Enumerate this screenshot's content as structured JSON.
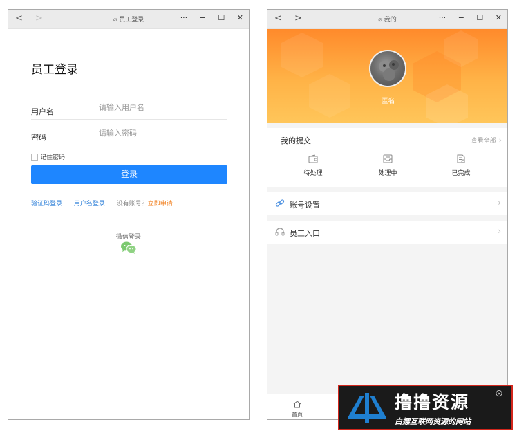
{
  "login_window": {
    "nav": {
      "back": "<",
      "forward": ">"
    },
    "title": "员工登录",
    "controls": {
      "more": "···",
      "minimize": "−",
      "maximize": "☐",
      "close": "✕"
    },
    "heading": "员工登录",
    "username": {
      "label": "用户名",
      "placeholder": "请输入用户名"
    },
    "password": {
      "label": "密码",
      "placeholder": "请输入密码"
    },
    "remember_label": "记住密码",
    "login_button": "登录",
    "links": {
      "sms_login": "验证码登录",
      "username_login": "用户名登录",
      "no_account": "没有账号？",
      "apply_now": "立即申请"
    },
    "wechat_label": "微信登录",
    "colors": {
      "primary": "#1e86ff",
      "link": "#2b7ed8",
      "apply": "#f07b17",
      "wechat": "#7bc96f"
    }
  },
  "profile_window": {
    "nav": {
      "back": "<",
      "forward": ">"
    },
    "title": "我的",
    "controls": {
      "more": "···",
      "minimize": "−",
      "maximize": "☐",
      "close": "✕"
    },
    "username": "匿名",
    "submissions": {
      "title": "我的提交",
      "view_all": "查看全部",
      "statuses": [
        {
          "label": "待处理",
          "icon": "wallet-icon"
        },
        {
          "label": "处理中",
          "icon": "inbox-icon"
        },
        {
          "label": "已完成",
          "icon": "document-done-icon"
        }
      ]
    },
    "menu": [
      {
        "label": "账号设置",
        "icon": "link-icon"
      },
      {
        "label": "员工入口",
        "icon": "headset-icon"
      }
    ],
    "tabbar": {
      "home": "首页"
    },
    "colors": {
      "banner_top": "#ff8a2b",
      "banner_bottom": "#ffc65a"
    }
  },
  "watermark": {
    "title": "撸撸资源",
    "registered": "®",
    "subtitle": "白嫖互联网资源的网站",
    "colors": {
      "background": "#1a1a1a",
      "border": "#d2261c",
      "logo": "#1f7fd0"
    }
  }
}
